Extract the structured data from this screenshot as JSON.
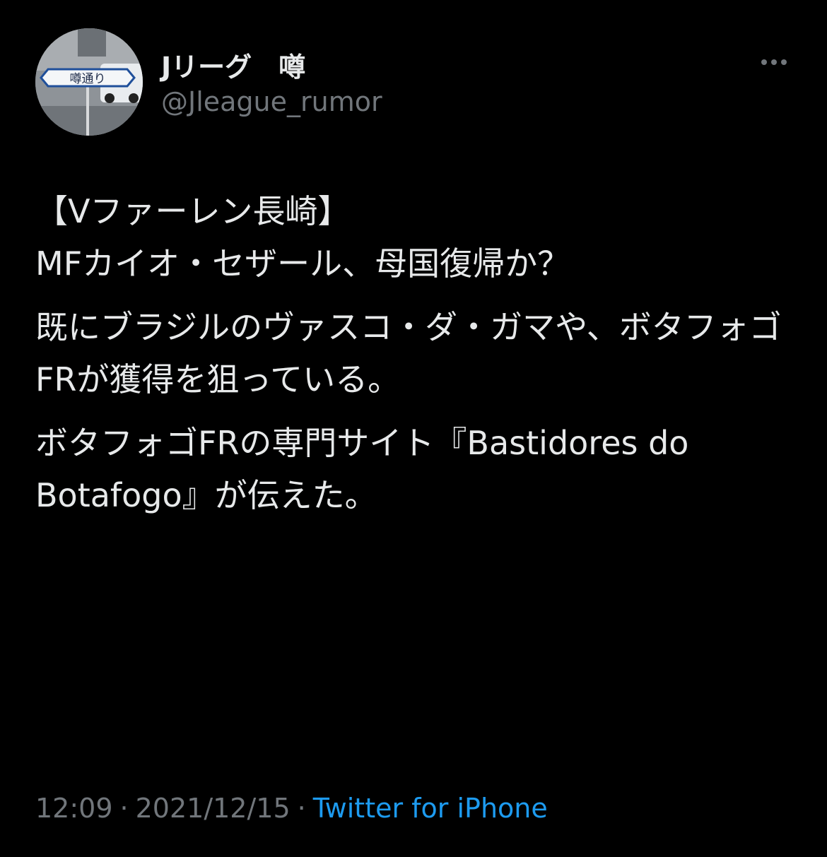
{
  "user": {
    "display_name": "Jリーグ　噂",
    "handle": "@Jleague_rumor",
    "avatar_sign_text": "噂通り"
  },
  "tweet": {
    "paragraphs": [
      "【Vファーレン長崎】\nMFカイオ・セザール、母国復帰か？",
      "既にブラジルのヴァスコ・ダ・ガマや、ボタフォゴFRが獲得を狙っている。",
      "ボタフォゴFRの専門サイト『Bastidores do Botafogo』が伝えた。"
    ]
  },
  "meta": {
    "time": "12:09",
    "separator": "·",
    "date": "2021/12/15",
    "source": "Twitter for iPhone"
  },
  "icons": {
    "more": "more-horizontal-icon"
  },
  "colors": {
    "background": "#000000",
    "text": "#e7e9ea",
    "secondary": "#71767b",
    "accent": "#1d9bf0"
  }
}
